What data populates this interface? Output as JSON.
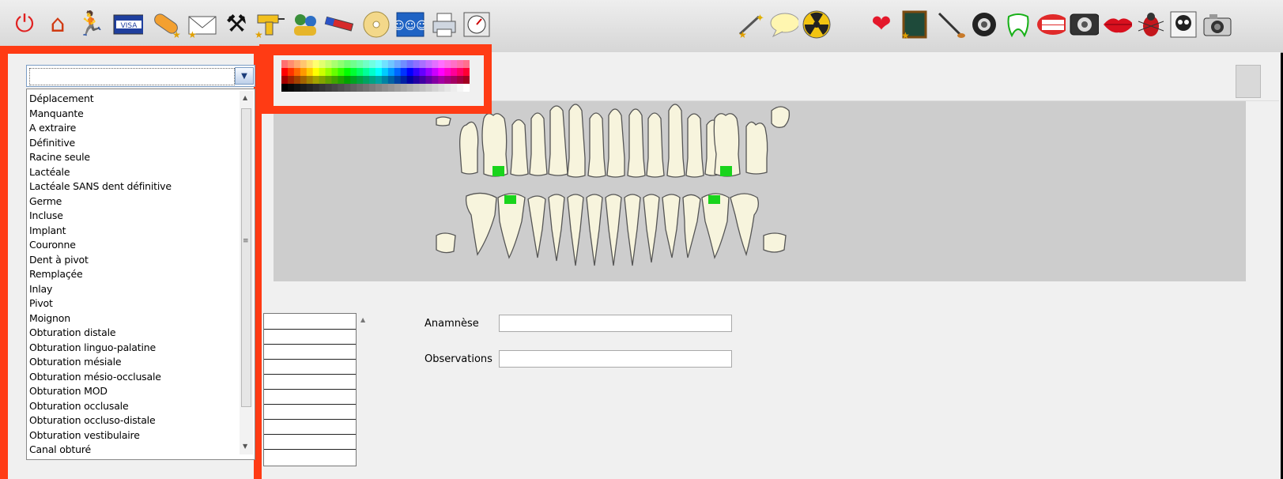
{
  "toolbar": {
    "left_icons": [
      "power-icon",
      "home-icon",
      "runner-icon",
      "visa-card-icon",
      "pill-icon",
      "envelope-icon",
      "worker-icon",
      "drill-icon",
      "users-icon",
      "pen-icon",
      "disc-icon",
      "group-icon",
      "printer-icon",
      "gauge-icon"
    ],
    "middle_icons": [
      "magic-wand-icon",
      "speech-bubble-icon",
      "radiation-icon"
    ],
    "right_icons": [
      "heart-icon",
      "slate-icon",
      "brush-icon",
      "gear-camera-icon",
      "tooth-outline-icon",
      "denture-icon",
      "xray-machine-icon",
      "lips-icon",
      "bug-icon",
      "skull-icon",
      "camera-icon"
    ]
  },
  "dropdown": {
    "selected_value": "",
    "options": [
      "Déplacement",
      "Manquante",
      "A extraire",
      "Définitive",
      "Racine seule",
      "Lactéale",
      "Lactéale SANS dent définitive",
      "Germe",
      "Incluse",
      "Implant",
      "Couronne",
      "Dent à pivot",
      "Remplaçée",
      "Inlay",
      "Pivot",
      "Moignon",
      "Obturation distale",
      "Obturation linguo-palatine",
      "Obturation mésiale",
      "Obturation mésio-occlusale",
      "Obturation MOD",
      "Obturation occlusale",
      "Obturation occluso-distale",
      "Obturation vestibulaire",
      "Canal obturé"
    ]
  },
  "form": {
    "anamnese_label": "Anamnèse",
    "anamnese_value": "",
    "observations_label": "Observations",
    "observations_value": ""
  },
  "colors": {
    "highlight_frame": "#ff3b14",
    "marker": "#19d41c",
    "chart_background": "#cdcdcd"
  }
}
